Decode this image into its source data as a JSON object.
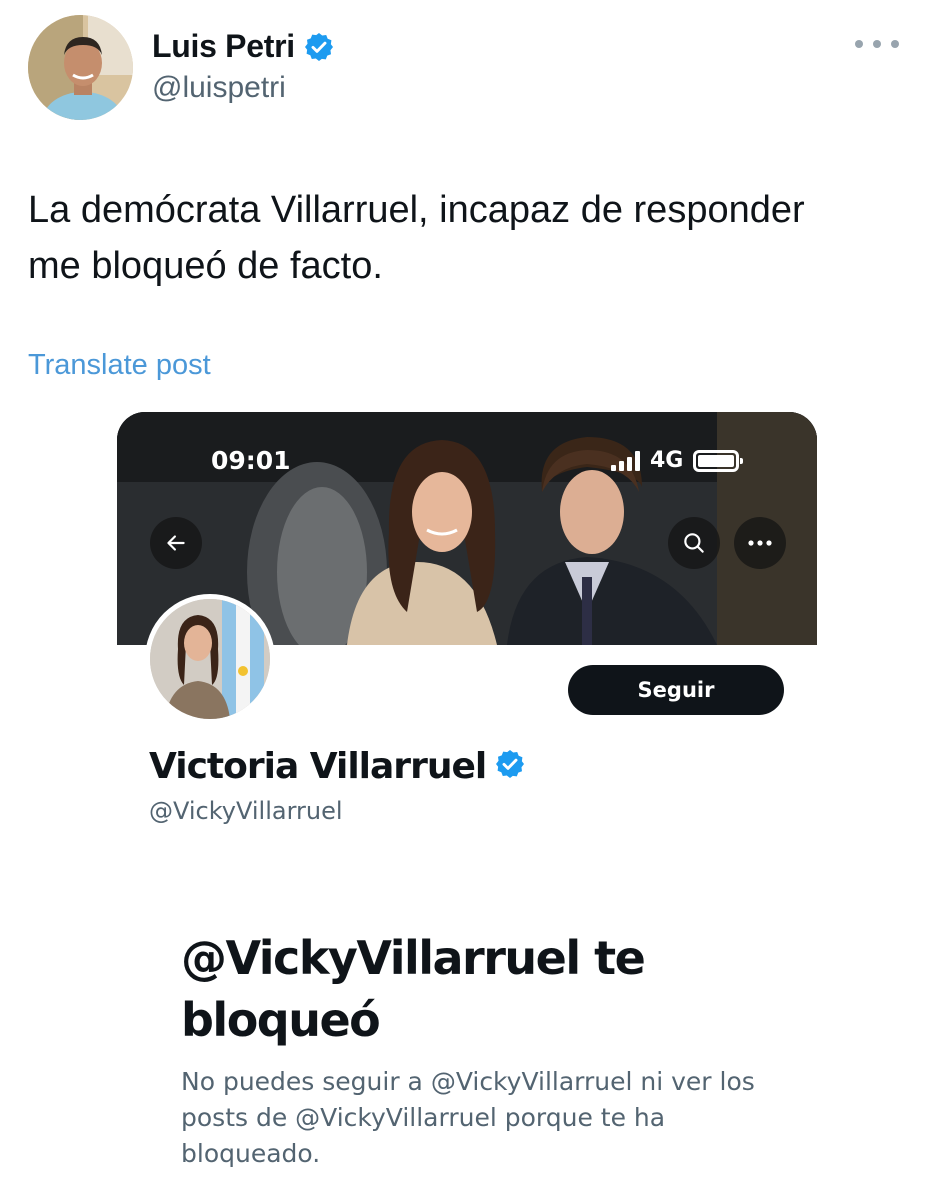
{
  "tweet": {
    "author_name": "Luis Petri",
    "author_handle": "@luispetri",
    "text_line1": "La demócrata Villarruel, incapaz de responder",
    "text_line2": "me bloqueó de facto.",
    "translate_label": "Translate post"
  },
  "embedded_screenshot": {
    "status_bar": {
      "time": "09:01",
      "network": "4G"
    },
    "profile": {
      "name": "Victoria Villarruel",
      "handle": "@VickyVillarruel",
      "follow_label": "Seguir"
    },
    "blocked_notice": {
      "title": "@VickyVillarruel te bloqueó",
      "description": "No puedes seguir a @VickyVillarruel ni ver los posts de @VickyVillarruel porque te ha bloqueado."
    }
  },
  "colors": {
    "verified_badge": "#1d9bf0",
    "link": "#4b98d8",
    "follow_button": "#0f1419",
    "secondary_text": "#536471"
  }
}
